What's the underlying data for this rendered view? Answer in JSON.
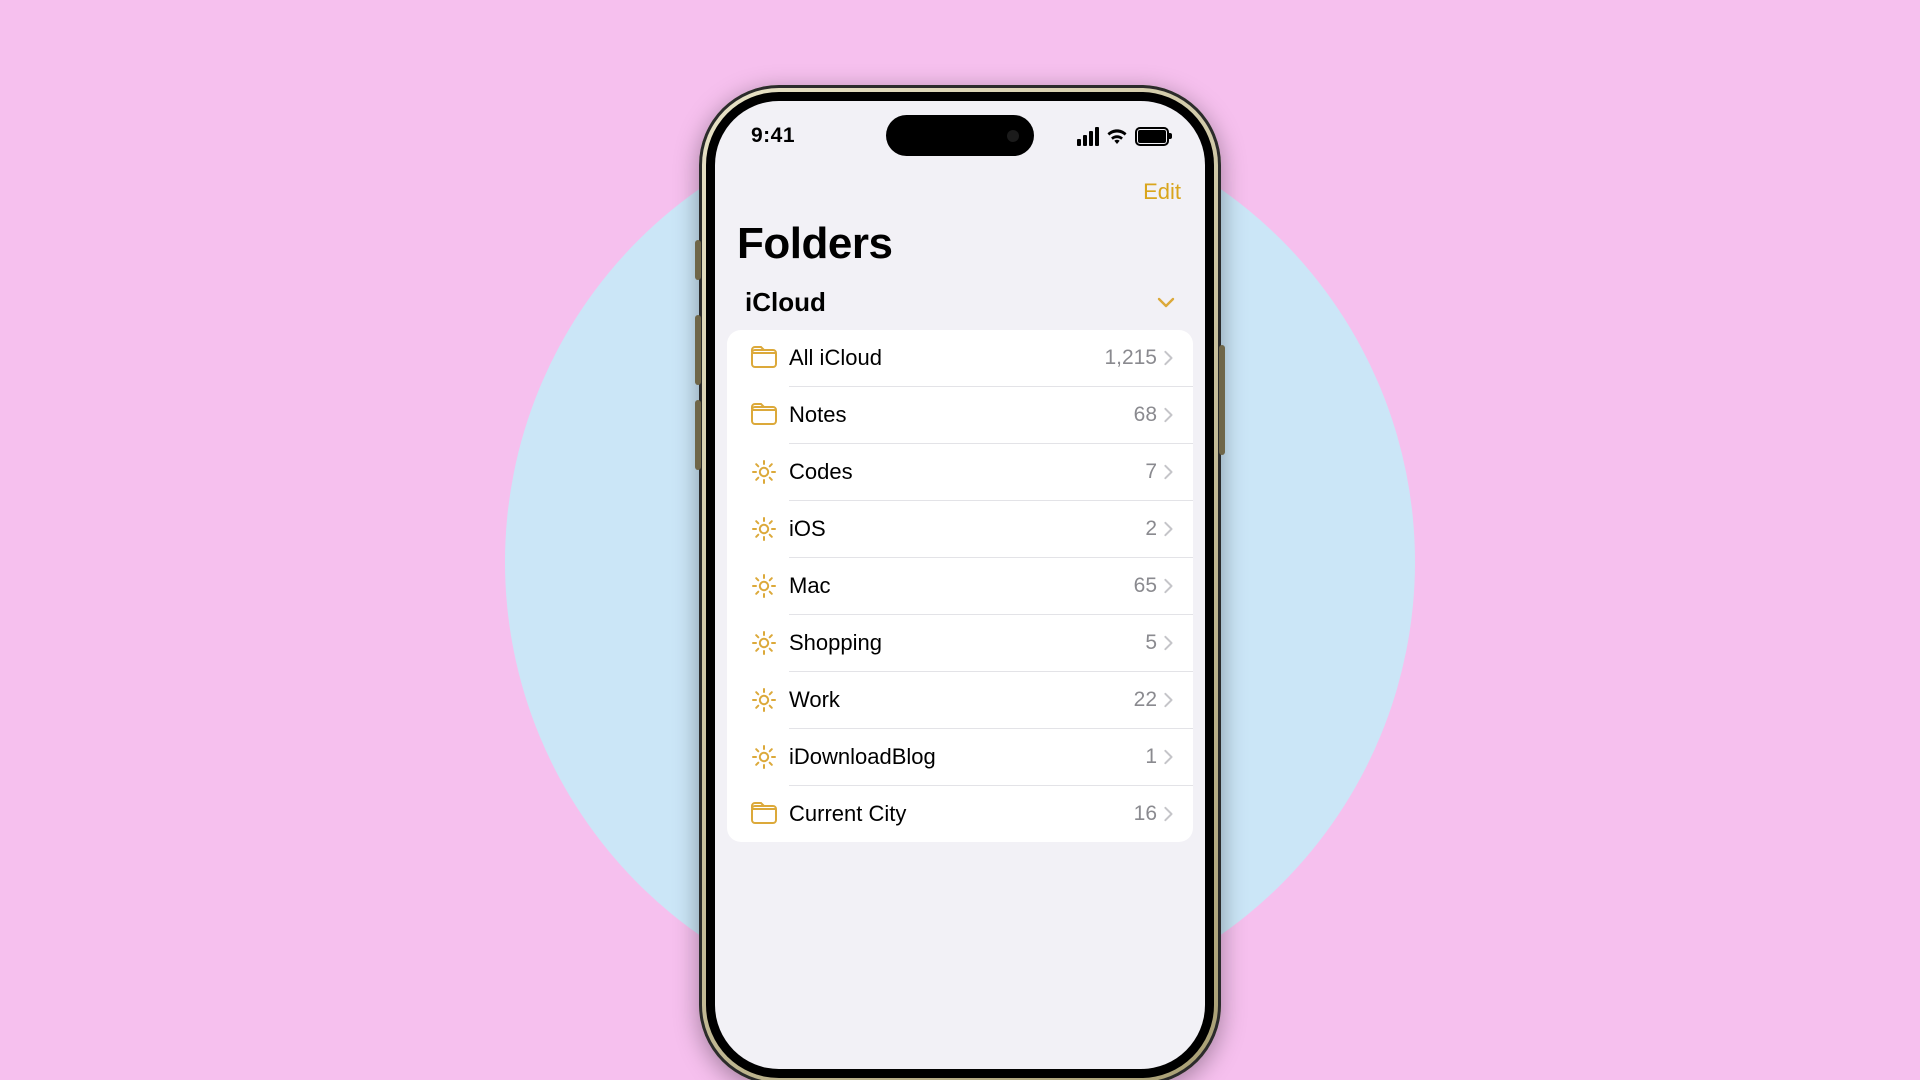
{
  "status": {
    "time": "9:41"
  },
  "nav": {
    "edit": "Edit"
  },
  "page": {
    "title": "Folders"
  },
  "section": {
    "name": "iCloud"
  },
  "folders": [
    {
      "icon": "folder",
      "label": "All iCloud",
      "count": "1,215"
    },
    {
      "icon": "folder",
      "label": "Notes",
      "count": "68"
    },
    {
      "icon": "gear",
      "label": "Codes",
      "count": "7"
    },
    {
      "icon": "gear",
      "label": "iOS",
      "count": "2"
    },
    {
      "icon": "gear",
      "label": "Mac",
      "count": "65"
    },
    {
      "icon": "gear",
      "label": "Shopping",
      "count": "5"
    },
    {
      "icon": "gear",
      "label": "Work",
      "count": "22"
    },
    {
      "icon": "gear",
      "label": "iDownloadBlog",
      "count": "1"
    },
    {
      "icon": "folder",
      "label": "Current City",
      "count": "16"
    }
  ],
  "colors": {
    "accent": "#d9a51c",
    "folderIcon": "#dca93a"
  }
}
